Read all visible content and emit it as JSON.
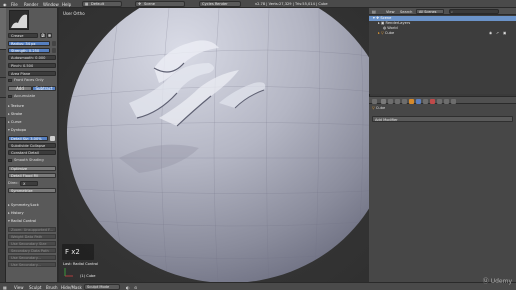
{
  "topbar": {
    "menus": [
      "File",
      "Render",
      "Window",
      "Help"
    ],
    "layout": "Default",
    "scene": "Scene",
    "engine": "Cycles Render",
    "stats": "v2.78 | Verts:27,329 | Tris:55,014 | Cube"
  },
  "toolshelf": {
    "crease": "Crease",
    "radius": "Radius: 34 px",
    "strength": "Strength: 0.250",
    "autosmooth": "Autosmooth: 0.000",
    "pinch": "Pinch: 0.500",
    "area_plane": "Area Plane",
    "front_faces": "Front Faces Only",
    "add": "Add",
    "subtract": "Subtract",
    "accumulate": "Accumulate",
    "texture": "Texture",
    "stroke": "Stroke",
    "curve": "Curve",
    "dyntopo": "Dyntopo",
    "detail_size": "Detail Siz: 3.00%",
    "subdivide_collapse": "Subdivide Collapse",
    "constant_detail": "Constant Detail",
    "smooth_shading": "Smooth Shading",
    "optimize": "Optimize",
    "detail_flood_fill": "Detail Flood Fill",
    "direc": "Direc:",
    "direc_value": "X",
    "symmetrize": "Symmetrize",
    "symmetry_lock": "Symmetry/Lock",
    "history": "History",
    "radial_control": "Radial Control",
    "faded_rows": [
      "Zoom: Unsupported F...",
      "Weight Data Path",
      "Use Secondary Size",
      "Secondary Data Path",
      "Use Secondary...",
      "Use Secondary..."
    ]
  },
  "viewport": {
    "view_label": "User Ortho",
    "key_overlay": "F x2",
    "last_op": "Last: Radial Control",
    "object": "(1) Cube"
  },
  "outliner": {
    "view": "View",
    "search": "Search",
    "all_scenes": "All Scenes",
    "rows": [
      "Scene",
      "RenderLayers",
      "World",
      "Cube"
    ]
  },
  "properties": {
    "crumb": "Cube",
    "add_modifier": "Add Modifier"
  },
  "bottombar": {
    "items": [
      "View",
      "Sculpt",
      "Brush",
      "Hide/Mask"
    ],
    "mode": "Sculpt Mode"
  },
  "watermark": "Udemy"
}
